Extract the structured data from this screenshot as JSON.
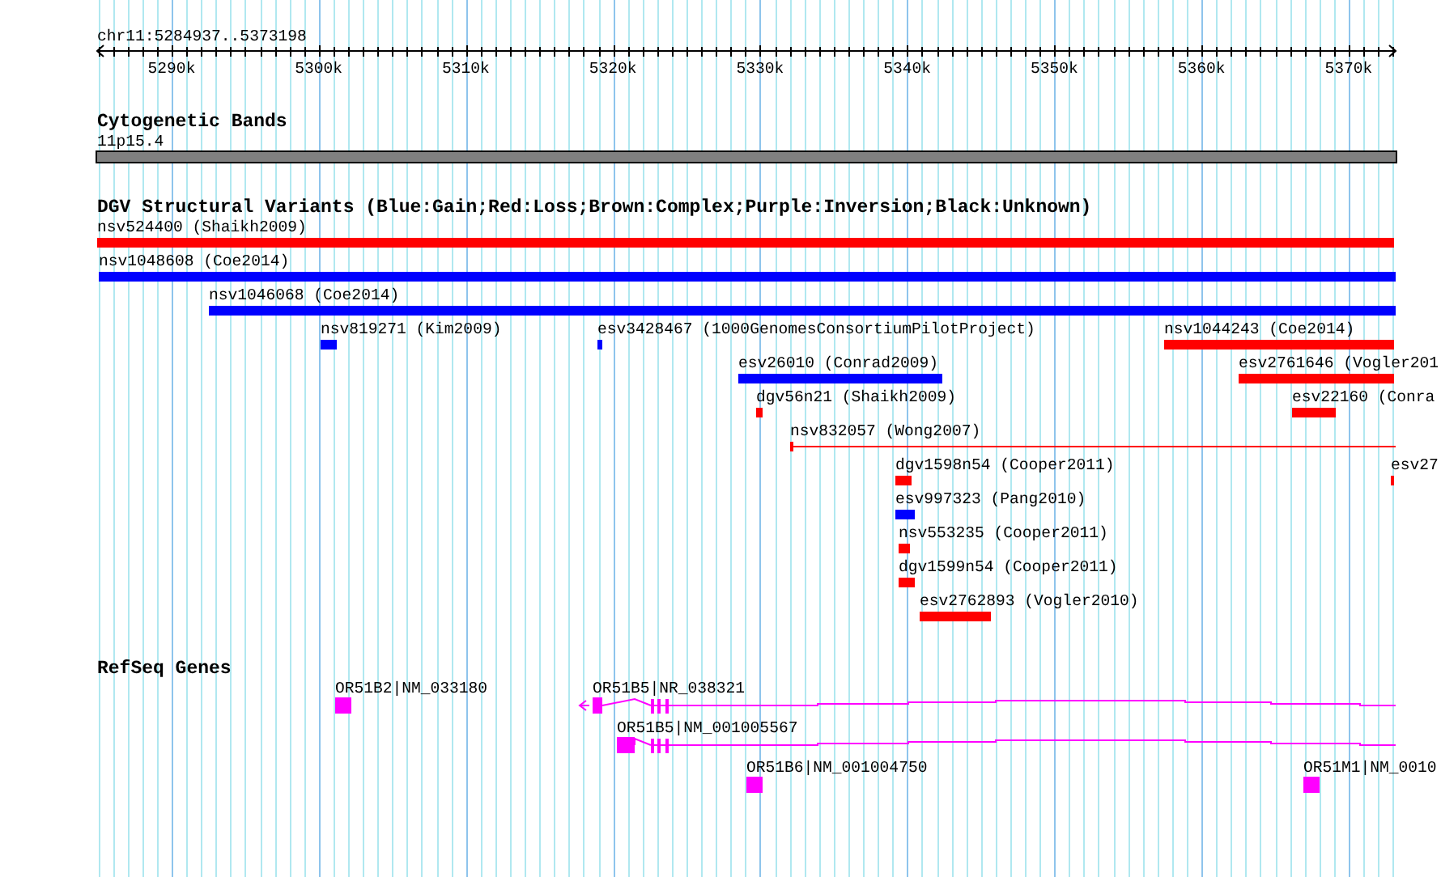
{
  "ruler": {
    "range": "chr11:5284937..5373198",
    "ticks": [
      "5290k",
      "5300k",
      "5310k",
      "5320k",
      "5330k",
      "5340k",
      "5350k",
      "5360k",
      "5370k"
    ]
  },
  "tracks": [
    {
      "title": "Cytogenetic Bands",
      "features": [
        {
          "label": "11p15.4",
          "kind": "band"
        }
      ]
    },
    {
      "title": "DGV Structural Variants (Blue:Gain;Red:Loss;Brown:Complex;Purple:Inversion;Black:Unknown)",
      "features": [
        {
          "label": "nsv524400 (Shaikh2009)",
          "kind": "bar",
          "color": "#ff0000"
        },
        {
          "label": "nsv1048608 (Coe2014)",
          "kind": "bar",
          "color": "#0000ff"
        },
        {
          "label": "nsv1046068 (Coe2014)",
          "kind": "bar",
          "color": "#0000ff"
        },
        {
          "label": "nsv819271 (Kim2009)",
          "kind": "bar",
          "color": "#0000ff"
        },
        {
          "label": "esv3428467 (1000GenomesConsortiumPilotProject)",
          "kind": "bar",
          "color": "#0000ff"
        },
        {
          "label": "nsv1044243 (Coe2014)",
          "kind": "bar",
          "color": "#ff0000"
        },
        {
          "label": "esv26010 (Conrad2009)",
          "kind": "bar",
          "color": "#0000ff"
        },
        {
          "label": "esv2761646 (Vogler201",
          "kind": "bar",
          "color": "#ff0000"
        },
        {
          "label": "dgv56n21 (Shaikh2009)",
          "kind": "bar",
          "color": "#ff0000"
        },
        {
          "label": "esv22160 (Conra",
          "kind": "bar",
          "color": "#ff0000"
        },
        {
          "label": "nsv832057 (Wong2007)",
          "kind": "line",
          "color": "#ff0000"
        },
        {
          "label": "dgv1598n54 (Cooper2011)",
          "kind": "bar",
          "color": "#ff0000"
        },
        {
          "label": "esv27",
          "kind": "bar",
          "color": "#ff0000"
        },
        {
          "label": "esv997323 (Pang2010)",
          "kind": "bar",
          "color": "#0000ff"
        },
        {
          "label": "nsv553235 (Cooper2011)",
          "kind": "bar",
          "color": "#ff0000"
        },
        {
          "label": "dgv1599n54 (Cooper2011)",
          "kind": "bar",
          "color": "#ff0000"
        },
        {
          "label": "esv2762893 (Vogler2010)",
          "kind": "bar",
          "color": "#ff0000"
        }
      ]
    },
    {
      "title": "RefSeq Genes",
      "features": [
        {
          "label": "OR51B2|NM_033180",
          "kind": "block"
        },
        {
          "label": "OR51B5|NR_038321",
          "kind": "transcript"
        },
        {
          "label": "OR51B5|NM_001005567",
          "kind": "transcript"
        },
        {
          "label": "OR51B6|NM_001004750",
          "kind": "block"
        },
        {
          "label": "OR51M1|NM_0010",
          "kind": "block"
        }
      ]
    }
  ]
}
